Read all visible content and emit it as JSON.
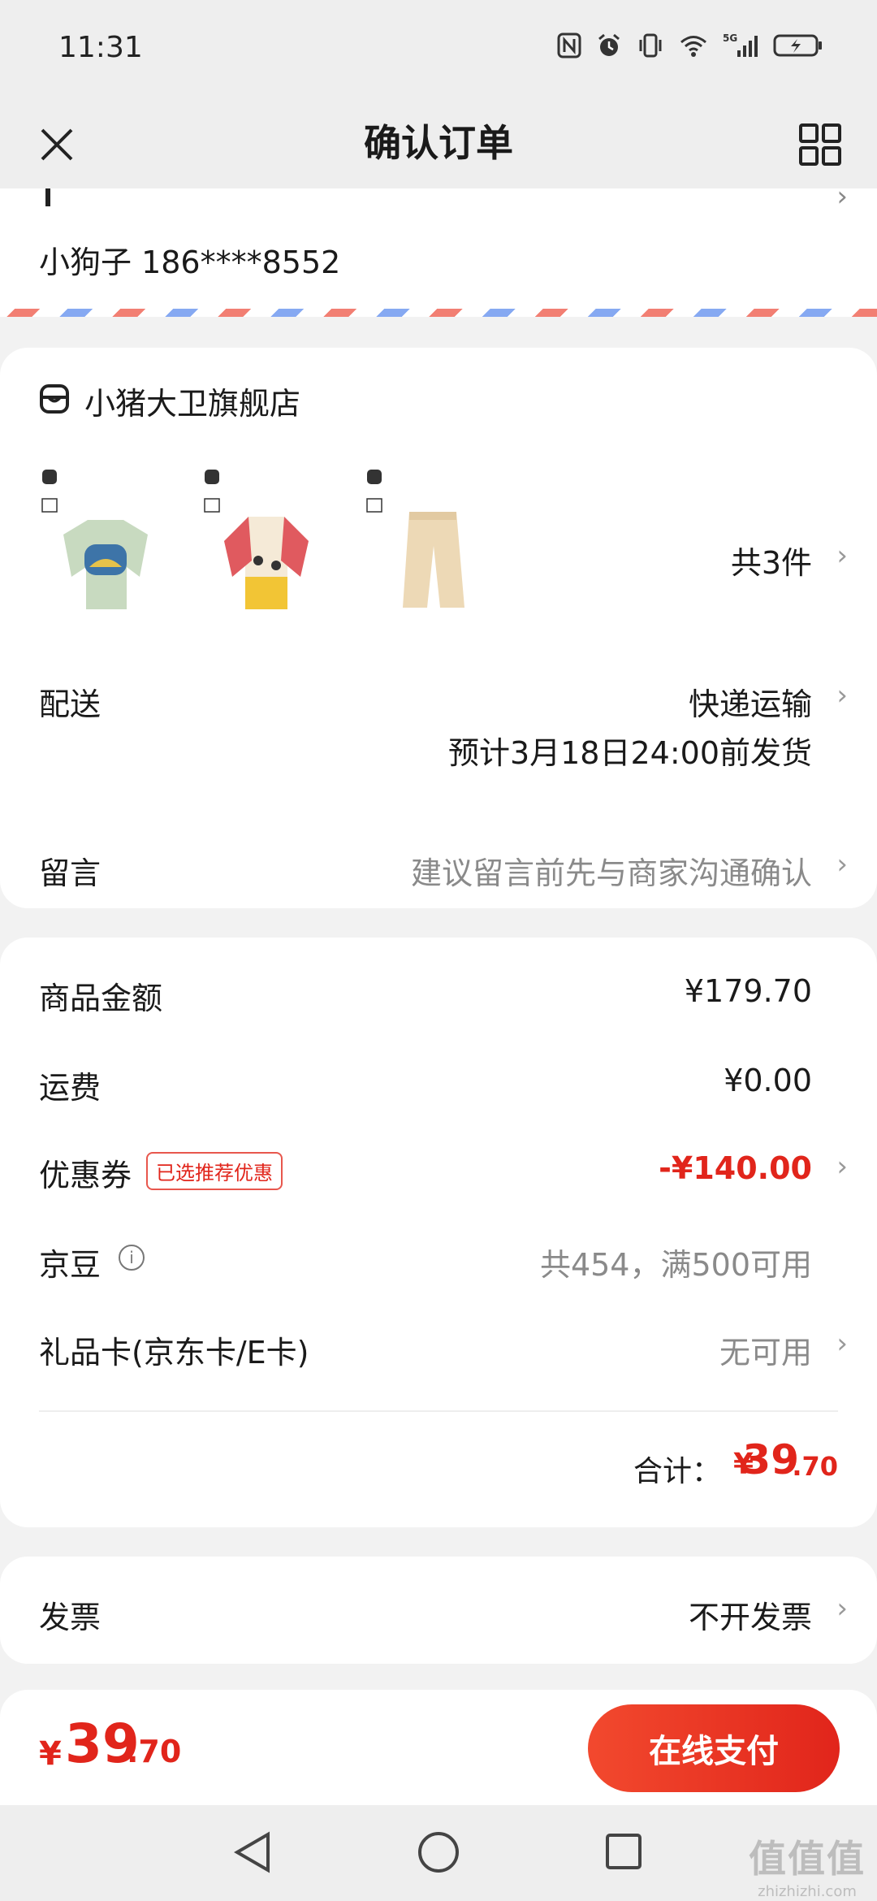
{
  "status_bar": {
    "time": "11:31",
    "icons": [
      "nfc-icon",
      "alarm-icon",
      "vibrate-icon",
      "wifi-icon",
      "signal-5g-icon",
      "battery-charging-icon"
    ]
  },
  "header": {
    "title": "确认订单",
    "close_icon": "close-icon",
    "menu_icon": "grid-icon"
  },
  "address": {
    "contact": "小狗子 186****8552"
  },
  "store": {
    "name": "小猪大卫旗舰店",
    "products": [
      {
        "label": "green-shirt"
      },
      {
        "label": "red-raglan-shirt"
      },
      {
        "label": "beige-pants"
      }
    ],
    "count": "共3件"
  },
  "delivery": {
    "label": "配送",
    "method": "快递运输",
    "eta": "预计3月18日24:00前发货"
  },
  "message": {
    "label": "留言",
    "placeholder": "建议留言前先与商家沟通确认"
  },
  "summary": {
    "goods_label": "商品金额",
    "goods_value": "¥179.70",
    "shipping_label": "运费",
    "shipping_value": "¥0.00",
    "coupon_label": "优惠券",
    "coupon_badge": "已选推荐优惠",
    "coupon_value": "-¥140.00",
    "beans_label": "京豆",
    "beans_value": "共454，满500可用",
    "giftcard_label": "礼品卡(京东卡/E卡)",
    "giftcard_value": "无可用",
    "total_label": "合计：",
    "total_yen": "¥",
    "total_int": "39",
    "total_dec": ".70"
  },
  "invoice": {
    "label": "发票",
    "value": "不开发票"
  },
  "pay_bar": {
    "yen": "¥",
    "amount_int": "39",
    "amount_dec": ".70",
    "button": "在线支付"
  },
  "watermark": {
    "main": "值值值",
    "sub": "zhizhizhi.com"
  },
  "colors": {
    "accent": "#e1251b",
    "airmail_red": "#f27f73",
    "airmail_blue": "#86a9f2"
  }
}
